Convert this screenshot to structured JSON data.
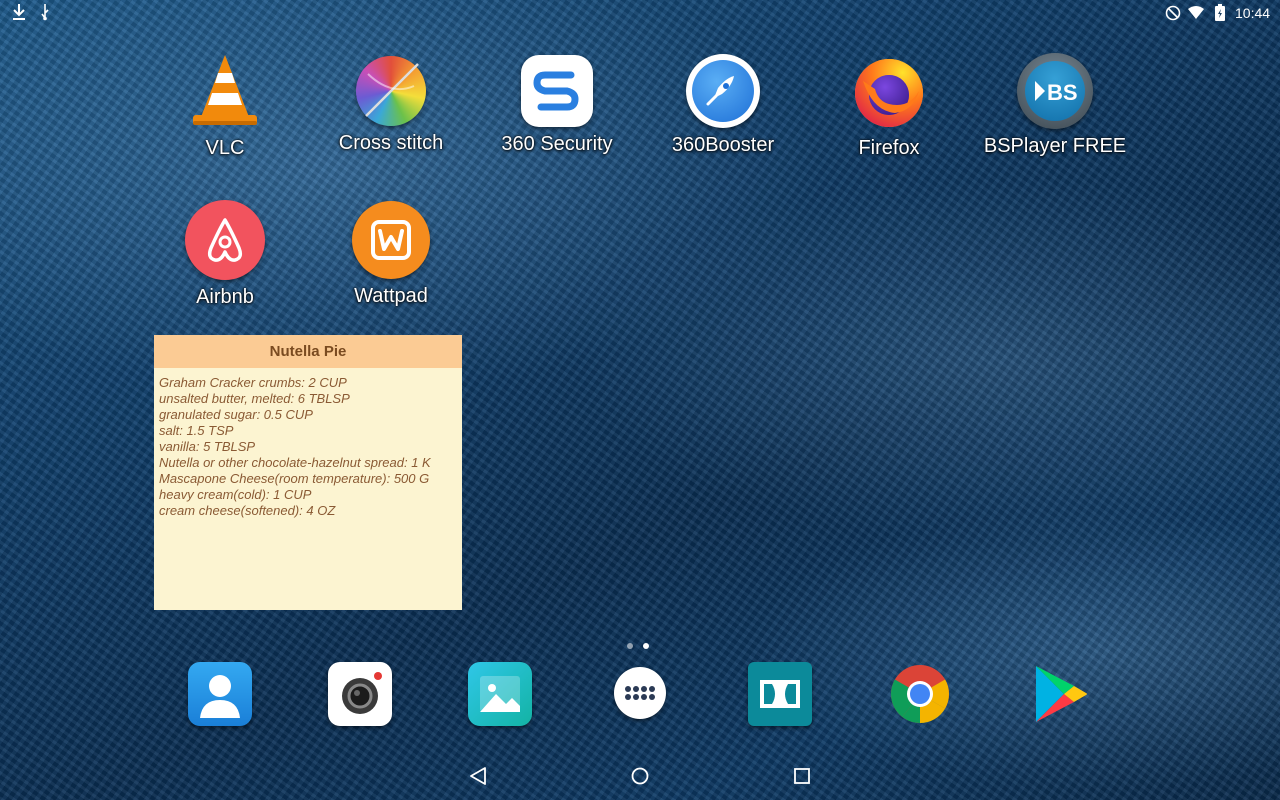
{
  "status_bar": {
    "time": "10:44",
    "left_icons": [
      "download-icon",
      "usb-icon"
    ],
    "right_icons": [
      "do-not-disturb-icon",
      "wifi-icon",
      "battery-charging-icon"
    ]
  },
  "apps": [
    {
      "label": "VLC",
      "icon": "vlc-icon"
    },
    {
      "label": "Cross stitch",
      "icon": "cross-stitch-icon"
    },
    {
      "label": "360 Security",
      "icon": "360-security-icon"
    },
    {
      "label": "360Booster",
      "icon": "360-booster-icon"
    },
    {
      "label": "Firefox",
      "icon": "firefox-icon"
    },
    {
      "label": "BSPlayer FREE",
      "icon": "bsplayer-icon"
    },
    {
      "label": "Airbnb",
      "icon": "airbnb-icon"
    },
    {
      "label": "Wattpad",
      "icon": "wattpad-icon"
    }
  ],
  "recipe_widget": {
    "title": "Nutella Pie",
    "ingredients": [
      "Graham Cracker crumbs: 2 CUP",
      "unsalted butter, melted: 6 TBLSP",
      "granulated sugar: 0.5 CUP",
      "salt: 1.5 TSP",
      "vanilla: 5 TBLSP",
      "Nutella or other chocolate-hazelnut spread: 1 K",
      "Mascapone Cheese(room temperature): 500 G",
      "heavy cream(cold): 1 CUP",
      "cream cheese(softened): 4 OZ"
    ]
  },
  "page_indicator": {
    "pages": 2,
    "current": 2
  },
  "dock": [
    "contacts-icon",
    "camera-icon",
    "gallery-icon",
    "app-drawer-icon",
    "dolby-icon",
    "chrome-icon",
    "play-store-icon"
  ],
  "nav": [
    "back-icon",
    "home-icon",
    "recents-icon"
  ],
  "colors": {
    "widget_bg": "#fcf4d1",
    "widget_header": "#fbcb94",
    "widget_text": "#8a5a34"
  }
}
